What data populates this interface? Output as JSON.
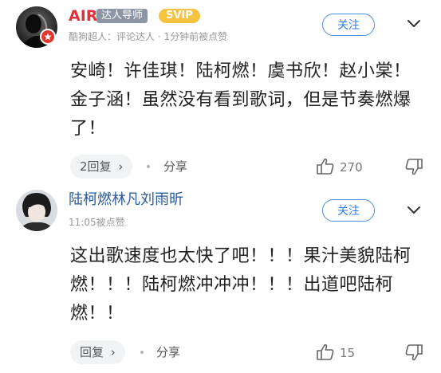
{
  "comments": [
    {
      "username": "AIR",
      "badge_talent": "达人导师",
      "badge_svip": "SVIP",
      "meta": "酷狗超人：评论达人 · 1分钟前被点赞",
      "follow_label": "关注",
      "content": "安崎！许佳琪！陆柯燃！虞书欣！赵小棠！金子涵！虽然没有看到歌词，但是节奏燃爆了！",
      "reply_label": "2回复",
      "share_label": "分享",
      "like_count": "270"
    },
    {
      "username": "陆柯燃林凡刘雨昕",
      "meta": "11:05被点赞",
      "follow_label": "关注",
      "content": "这出歌速度也太快了吧！！！果汁美貌陆柯燃！！！陆柯燃冲冲冲！！！出道吧陆柯燃！！",
      "reply_label": "回复",
      "share_label": "分享",
      "like_count": "15"
    }
  ],
  "colors": {
    "username1": "#e0323a",
    "badge_talent_bg": "#8c96a5",
    "badge_svip_bg": "#f4c440",
    "follow_blue": "#2f80ed",
    "username2": "#2a5a9a"
  },
  "icons": [
    "chevron-right-icon",
    "thumb-up-icon",
    "thumb-down-icon",
    "more-icon"
  ]
}
